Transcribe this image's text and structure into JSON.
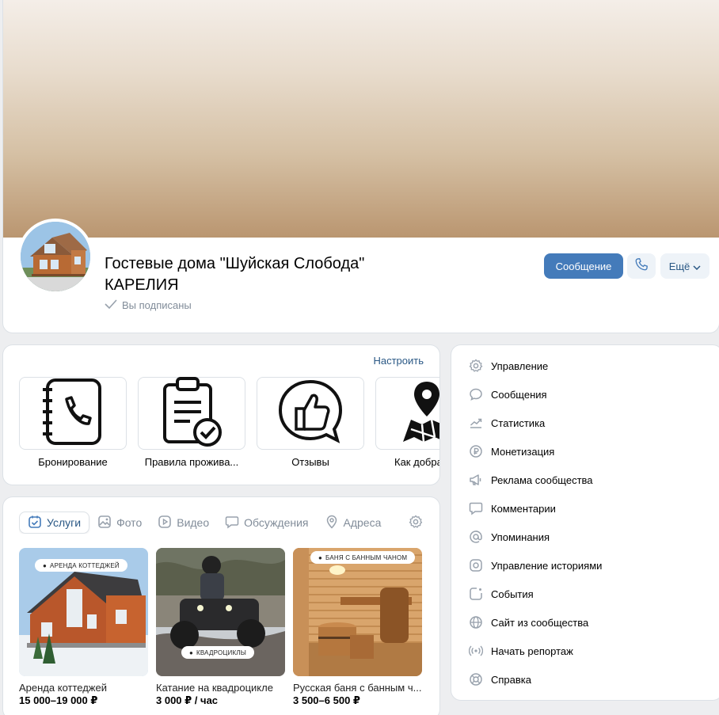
{
  "community": {
    "name": "Гостевые дома \"Шуйская Слобода\" КАРЕЛИЯ",
    "subscribed_label": "Вы подписаны"
  },
  "actions": {
    "message_label": "Сообщение",
    "more_label": "Ещё"
  },
  "links": {
    "customize_label": "Настроить",
    "items": [
      {
        "label": "Бронирование",
        "icon": "phone-book-icon"
      },
      {
        "label": "Правила прожива...",
        "icon": "clipboard-check-icon"
      },
      {
        "label": "Отзывы",
        "icon": "thumbs-up-bubble-icon"
      },
      {
        "label": "Как добра",
        "icon": "map-pin-icon"
      }
    ]
  },
  "tabs": [
    {
      "label": "Услуги",
      "icon": "calendar-check-icon",
      "active": true
    },
    {
      "label": "Фото",
      "icon": "photo-icon",
      "active": false
    },
    {
      "label": "Видео",
      "icon": "play-icon",
      "active": false
    },
    {
      "label": "Обсуждения",
      "icon": "chat-icon",
      "active": false
    },
    {
      "label": "Адреса",
      "icon": "location-icon",
      "active": false
    }
  ],
  "services": [
    {
      "badge": "АРЕНДА КОТТЕДЖЕЙ",
      "name": "Аренда коттеджей",
      "price": "15 000–19 000 ₽"
    },
    {
      "badge": "КВАДРОЦИКЛЫ",
      "name": "Катание на квадроцикле",
      "price": "3 000 ₽ / час"
    },
    {
      "badge": "БАНЯ С БАННЫМ ЧАНОМ",
      "name": "Русская баня с банным ч...",
      "price": "3 500–6 500 ₽"
    }
  ],
  "menu": [
    {
      "label": "Управление",
      "icon": "gear-icon"
    },
    {
      "label": "Сообщения",
      "icon": "message-bubble-icon"
    },
    {
      "label": "Статистика",
      "icon": "chart-trend-icon"
    },
    {
      "label": "Монетизация",
      "icon": "ruble-icon"
    },
    {
      "label": "Реклама сообщества",
      "icon": "megaphone-icon"
    },
    {
      "label": "Комментарии",
      "icon": "comment-icon"
    },
    {
      "label": "Упоминания",
      "icon": "at-icon"
    },
    {
      "label": "Управление историями",
      "icon": "stories-icon"
    },
    {
      "label": "События",
      "icon": "event-icon"
    },
    {
      "label": "Сайт из сообщества",
      "icon": "globe-icon"
    },
    {
      "label": "Начать репортаж",
      "icon": "broadcast-icon"
    },
    {
      "label": "Справка",
      "icon": "lifebuoy-icon"
    }
  ],
  "colors": {
    "accent": "#447bba",
    "link": "#2a5885",
    "muted": "#818c99",
    "background": "#edeef0"
  }
}
